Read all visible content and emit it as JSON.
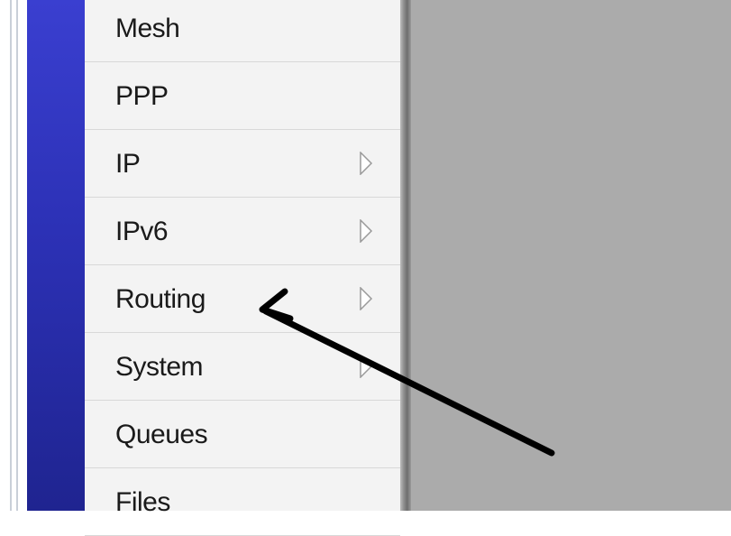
{
  "menu": {
    "items": [
      {
        "label": "Mesh",
        "has_submenu": false
      },
      {
        "label": "PPP",
        "has_submenu": false
      },
      {
        "label": "IP",
        "has_submenu": true
      },
      {
        "label": "IPv6",
        "has_submenu": true
      },
      {
        "label": "Routing",
        "has_submenu": true
      },
      {
        "label": "System",
        "has_submenu": true
      },
      {
        "label": "Queues",
        "has_submenu": false
      },
      {
        "label": "Files",
        "has_submenu": false
      }
    ]
  },
  "annotation": {
    "icon": "pointer-arrow-icon",
    "points_to": "Routing",
    "color": "#000000"
  },
  "colors": {
    "brand_strip": "#2c31b6",
    "menu_background": "#f3f3f3",
    "workspace_background": "#ababab"
  }
}
